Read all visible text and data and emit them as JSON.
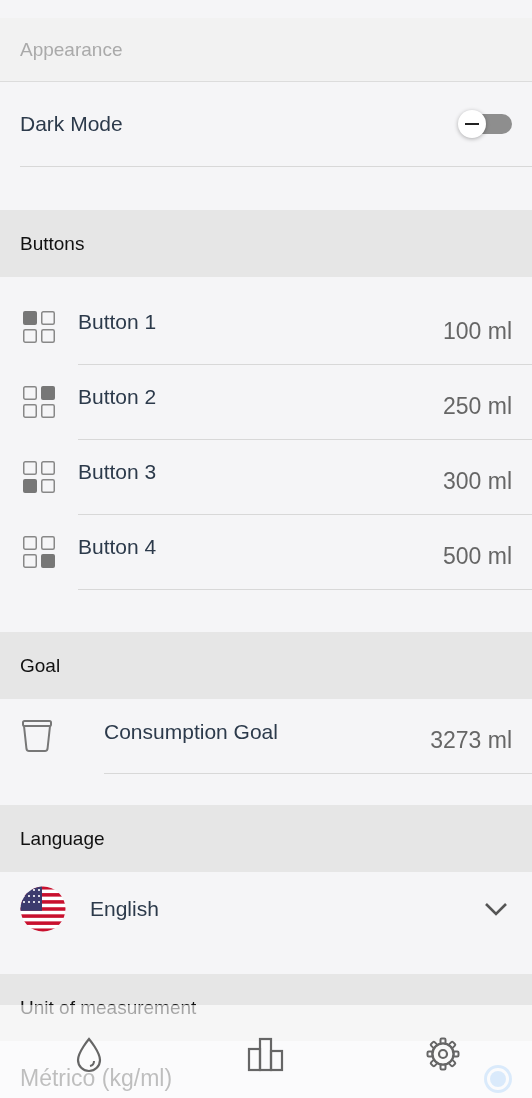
{
  "appearance": {
    "header": "Appearance",
    "dark_mode": {
      "label": "Dark Mode",
      "on": false
    }
  },
  "buttons": {
    "header": "Buttons",
    "items": [
      {
        "label": "Button 1",
        "value": "100 ml"
      },
      {
        "label": "Button 2",
        "value": "250 ml"
      },
      {
        "label": "Button 3",
        "value": "300 ml"
      },
      {
        "label": "Button 4",
        "value": "500 ml"
      }
    ]
  },
  "goal": {
    "header": "Goal",
    "label": "Consumption Goal",
    "value": "3273 ml"
  },
  "language": {
    "header": "Language",
    "value": "English"
  },
  "units": {
    "header": "Unit of measurement",
    "options": [
      {
        "label": "Métrico (kg/ml)",
        "selected": true
      }
    ]
  }
}
